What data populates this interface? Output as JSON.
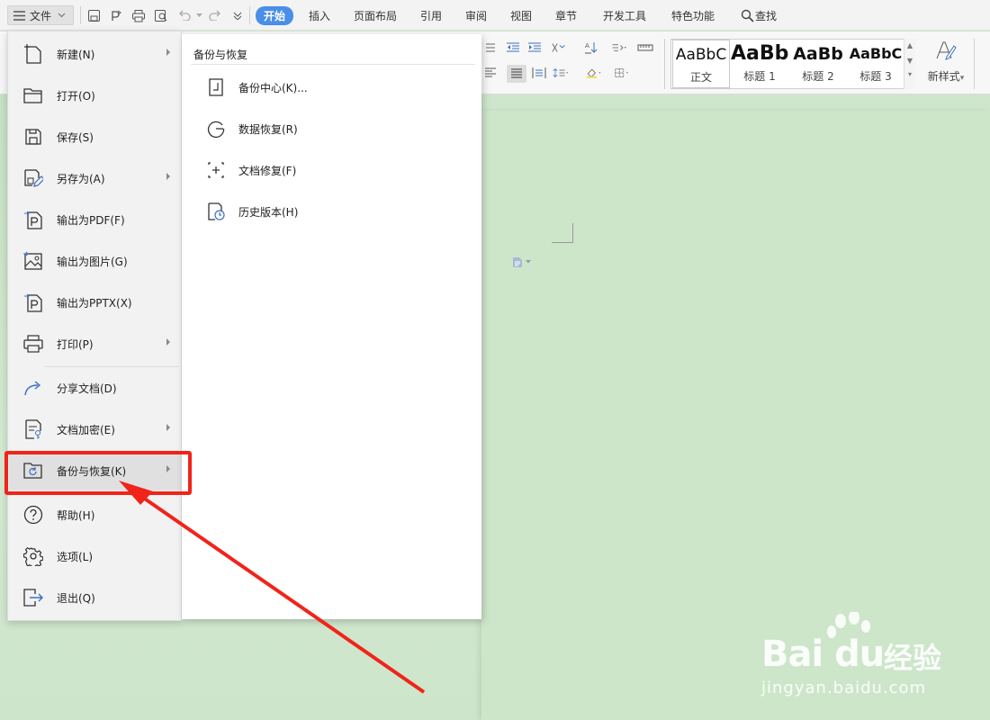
{
  "tabbar": {
    "file_label": "文件",
    "tabs": [
      "开始",
      "插入",
      "页面布局",
      "引用",
      "审阅",
      "视图",
      "章节",
      "开发工具",
      "特色功能"
    ],
    "search_label": "查找"
  },
  "ribbon": {
    "styles": [
      {
        "preview": "AaBbC",
        "label": "正文"
      },
      {
        "preview": "AaBb",
        "label": "标题 1"
      },
      {
        "preview": "AaBb",
        "label": "标题 2"
      },
      {
        "preview": "AaBbC",
        "label": "标题 3"
      }
    ],
    "new_style_label": "新样式",
    "new_style_arrow": "▾"
  },
  "file_menu": {
    "items": [
      {
        "label": "新建(N)",
        "icon": "new-doc-icon",
        "submenu": true
      },
      {
        "label": "打开(O)",
        "icon": "open-folder-icon",
        "submenu": false
      },
      {
        "label": "保存(S)",
        "icon": "save-icon",
        "submenu": false
      },
      {
        "label": "另存为(A)",
        "icon": "save-as-icon",
        "submenu": true
      },
      {
        "label": "输出为PDF(F)",
        "icon": "export-pdf-icon",
        "submenu": false
      },
      {
        "label": "输出为图片(G)",
        "icon": "export-image-icon",
        "submenu": false
      },
      {
        "label": "输出为PPTX(X)",
        "icon": "export-pptx-icon",
        "submenu": false
      },
      {
        "label": "打印(P)",
        "icon": "print-icon",
        "submenu": true
      },
      {
        "label": "分享文档(D)",
        "icon": "share-icon",
        "submenu": false
      },
      {
        "label": "文档加密(E)",
        "icon": "encrypt-icon",
        "submenu": true
      },
      {
        "label": "备份与恢复(K)",
        "icon": "backup-icon",
        "submenu": true,
        "selected": true
      },
      {
        "label": "帮助(H)",
        "icon": "help-icon",
        "submenu": false
      },
      {
        "label": "选项(L)",
        "icon": "options-gear-icon",
        "submenu": false
      },
      {
        "label": "退出(Q)",
        "icon": "exit-icon",
        "submenu": false
      }
    ]
  },
  "submenu": {
    "title": "备份与恢复",
    "items": [
      {
        "label": "备份中心(K)...",
        "icon": "backup-center-icon"
      },
      {
        "label": "数据恢复(R)",
        "icon": "data-recovery-icon"
      },
      {
        "label": "文档修复(F)",
        "icon": "doc-repair-icon"
      },
      {
        "label": "历史版本(H)",
        "icon": "history-version-icon"
      }
    ]
  },
  "watermark": {
    "logo": "Bai du",
    "cn": "经验",
    "url": "jingyan.baidu.com"
  },
  "colors": {
    "accent": "#4a8ee8",
    "annotation_red": "#f0241a",
    "doc_bg": "#cde6ca"
  }
}
